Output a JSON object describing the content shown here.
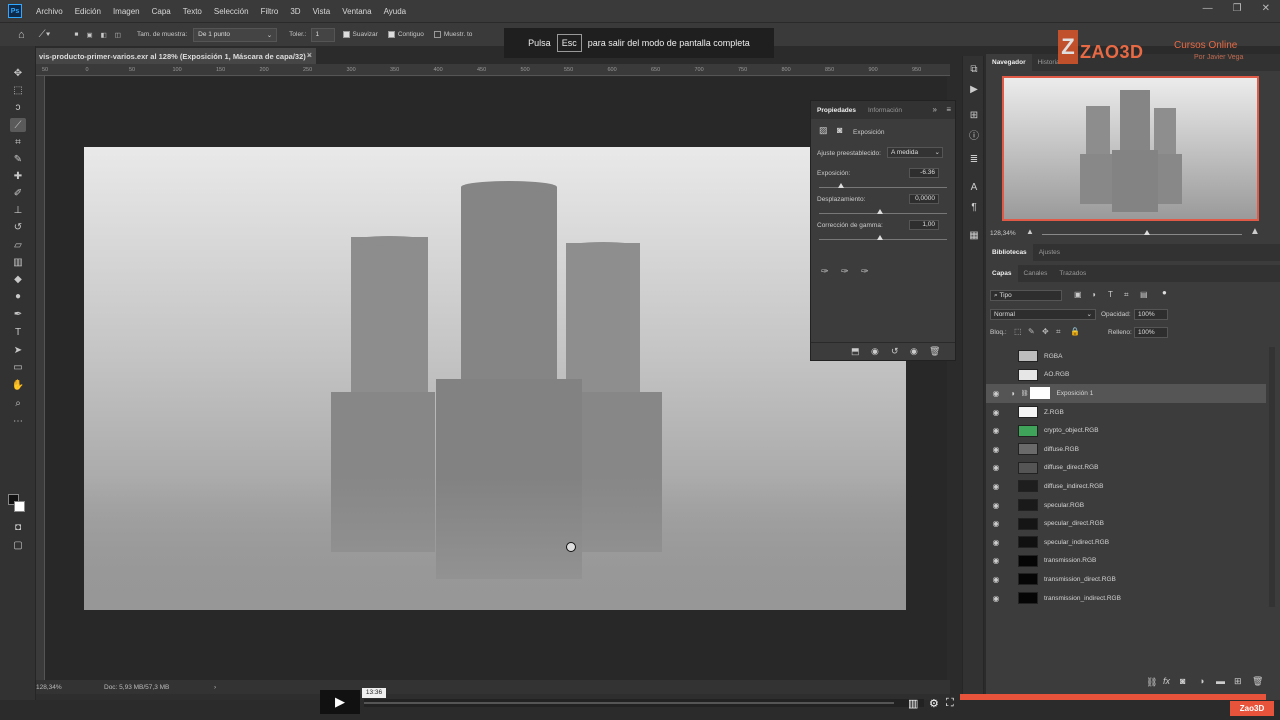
{
  "menu": [
    "Archivo",
    "Edición",
    "Imagen",
    "Capa",
    "Texto",
    "Selección",
    "Filtro",
    "3D",
    "Vista",
    "Ventana",
    "Ayuda"
  ],
  "options": {
    "sample_size_label": "Tam. de muestra:",
    "sample_size_value": "De 1 punto",
    "tolerance_label": "Toler.:",
    "tolerance_value": "1",
    "antialias_label": "Suavizar",
    "contiguous_label": "Contiguo",
    "sample_all_label": "Muestr. to"
  },
  "fullscreen_notice": {
    "pre": "Pulsa",
    "key": "Esc",
    "post": "para salir del modo de pantalla completa"
  },
  "document": {
    "tab_title": "vis-producto-primer-varios.exr al 128% (Exposición 1, Máscara de capa/32) *",
    "ruler_ticks": [
      "50",
      "0",
      "50",
      "100",
      "150",
      "200",
      "250",
      "300",
      "350",
      "400",
      "450",
      "500",
      "550",
      "600",
      "650",
      "700",
      "750",
      "800",
      "850",
      "900",
      "950"
    ],
    "zoom": "128,34%",
    "doc_info": "Doc: 5,93 MB/57,3 MB"
  },
  "properties": {
    "tabs": [
      "Propiedades",
      "Información"
    ],
    "type_label": "Exposición",
    "preset_label": "Ajuste preestablecido:",
    "preset_value": "A medida",
    "exposure_label": "Exposición:",
    "exposure_value": "-6.36",
    "offset_label": "Desplazamiento:",
    "offset_value": "0,0000",
    "gamma_label": "Corrección de gamma:",
    "gamma_value": "1,00"
  },
  "navigator": {
    "tabs": [
      "Navegador",
      "Historia"
    ],
    "zoom": "128,34%"
  },
  "libraries": {
    "tabs": [
      "Bibliotecas",
      "Ajustes"
    ]
  },
  "layers": {
    "tabs": [
      "Capas",
      "Canales",
      "Trazados"
    ],
    "filter_label": "Tipo",
    "blend_mode": "Normal",
    "opacity_label": "Opacidad:",
    "opacity_value": "100%",
    "lock_label": "Bloq.:",
    "fill_label": "Relleno:",
    "fill_value": "100%",
    "items": [
      {
        "name": "RGBA",
        "visible": false,
        "thumb": "#bdbdbd"
      },
      {
        "name": "AO.RGB",
        "visible": false,
        "thumb": "#e6e6e6"
      },
      {
        "name": "Exposición 1",
        "visible": true,
        "thumb": "#ffffff"
      },
      {
        "name": "Z.RGB",
        "visible": true,
        "thumb": "#f4f4f4"
      },
      {
        "name": "crypto_object.RGB",
        "visible": true,
        "thumb": "#3fa45a"
      },
      {
        "name": "diffuse.RGB",
        "visible": true,
        "thumb": "#6a6a6a"
      },
      {
        "name": "diffuse_direct.RGB",
        "visible": true,
        "thumb": "#555555"
      },
      {
        "name": "diffuse_indirect.RGB",
        "visible": true,
        "thumb": "#1e1e1e"
      },
      {
        "name": "specular.RGB",
        "visible": true,
        "thumb": "#1a1a1a"
      },
      {
        "name": "specular_direct.RGB",
        "visible": true,
        "thumb": "#151515"
      },
      {
        "name": "specular_indirect.RGB",
        "visible": true,
        "thumb": "#101010"
      },
      {
        "name": "transmission.RGB",
        "visible": true,
        "thumb": "#050505"
      },
      {
        "name": "transmission_direct.RGB",
        "visible": true,
        "thumb": "#050505"
      },
      {
        "name": "transmission_indirect.RGB",
        "visible": true,
        "thumb": "#050505"
      }
    ]
  },
  "watermark": {
    "name": "ZAO3D",
    "line1": "Cursos Online",
    "line2": "Por Javier Vega"
  },
  "video": {
    "time": "13:36",
    "brand": "Zao3D"
  },
  "colors": {
    "accent_orange": "#e8533c",
    "selected_layer": "#555555"
  }
}
